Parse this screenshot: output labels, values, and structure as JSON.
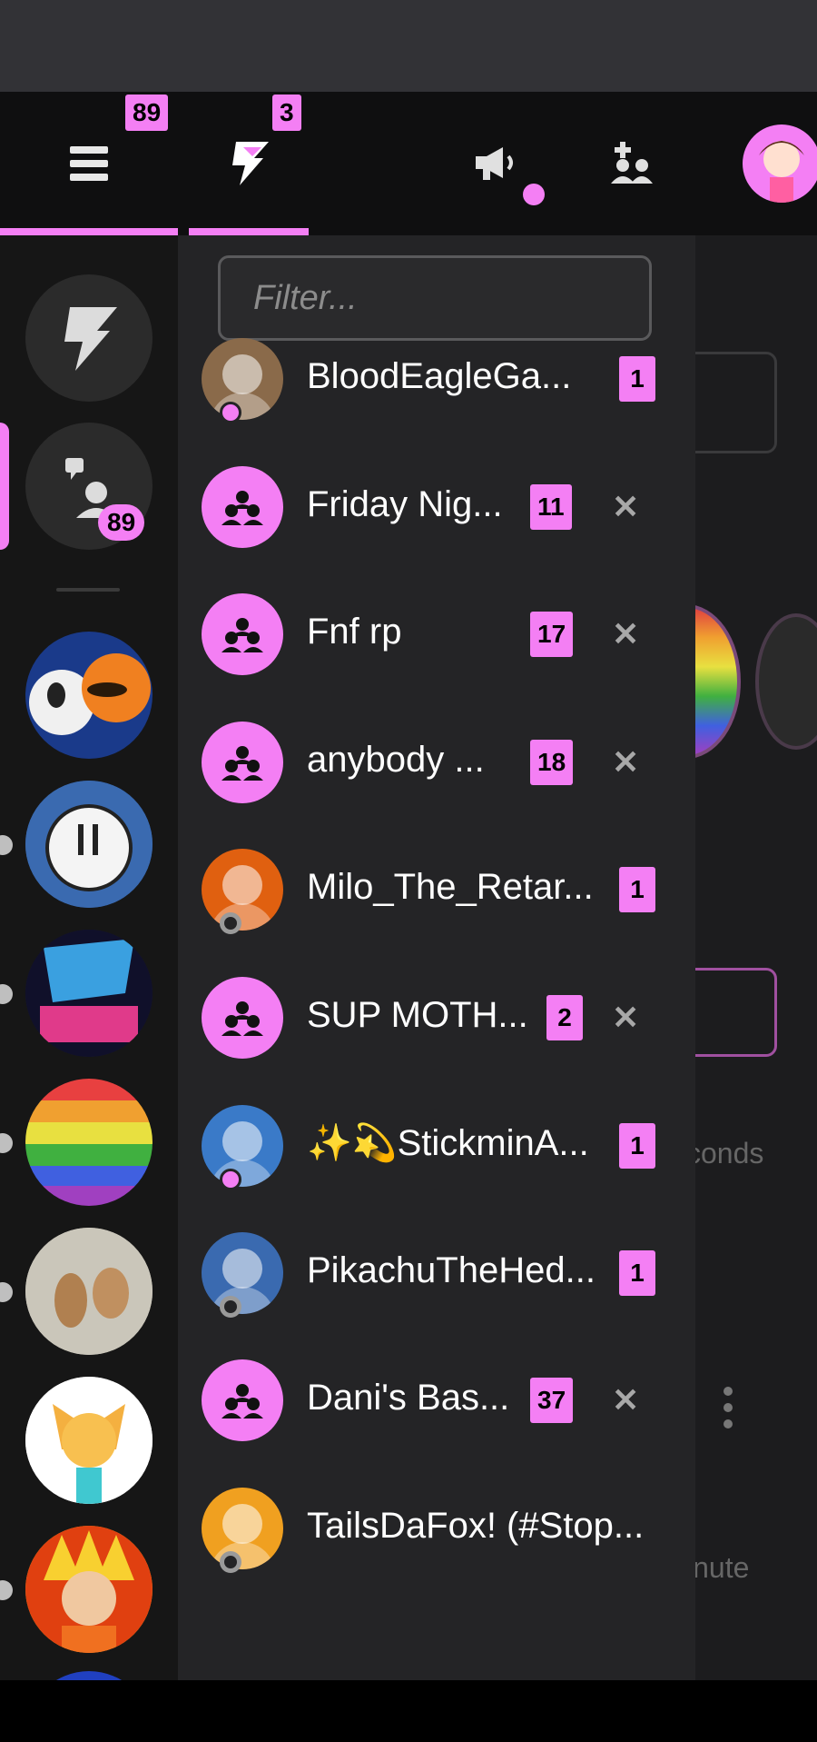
{
  "topbar": {
    "menu_badge": "89",
    "notifications_badge": "3"
  },
  "filter": {
    "placeholder": "Filter..."
  },
  "left_rail": {
    "chat_badge": "89"
  },
  "background": {
    "text_1": "conds",
    "text_2": "inute"
  },
  "threads": [
    {
      "name": "BloodEagleGa...",
      "badge": "1",
      "type": "user",
      "presence": "online",
      "closable": false
    },
    {
      "name": "Friday Nig...",
      "badge": "11",
      "type": "group",
      "closable": true
    },
    {
      "name": "Fnf rp",
      "badge": "17",
      "type": "group",
      "closable": true
    },
    {
      "name": "anybody ...",
      "badge": "18",
      "type": "group",
      "closable": true
    },
    {
      "name": "Milo_The_Retar...",
      "badge": "1",
      "type": "user",
      "presence": "offline",
      "closable": false
    },
    {
      "name": "SUP MOTH...",
      "badge": "2",
      "type": "group",
      "closable": true
    },
    {
      "name": "✨💫StickminA...",
      "badge": "1",
      "type": "user",
      "presence": "online",
      "closable": false
    },
    {
      "name": "PikachuTheHed...",
      "badge": "1",
      "type": "user",
      "presence": "offline",
      "closable": false
    },
    {
      "name": "Dani's Bas...",
      "badge": "37",
      "type": "group",
      "closable": true
    },
    {
      "name": "TailsDaFox! (#Stop...",
      "badge": "",
      "type": "user",
      "presence": "offline",
      "closable": false
    }
  ],
  "colors": {
    "accent": "#f47ff4",
    "panel": "#242426",
    "topbar": "#0f0f10"
  }
}
